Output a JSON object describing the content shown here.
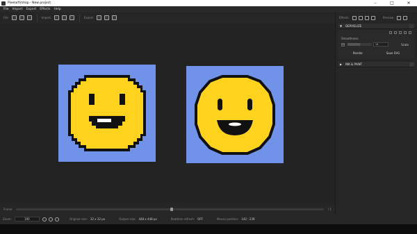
{
  "window": {
    "title": "PixelartVshop - New project",
    "minimize": "–",
    "maximize": "□",
    "close": "✕"
  },
  "menu": [
    "File",
    "Import",
    "Export",
    "Effects",
    "Help"
  ],
  "toolbar": {
    "file_label": "File",
    "import_label": "Import",
    "export_label": "Export"
  },
  "effects_bar": {
    "effects_label": "Effects",
    "preview_label": "Preview"
  },
  "panels": {
    "depixelize": {
      "title": "DEPIXELIZE",
      "collapse_arrow": "▼",
      "smoothness_label": "Smoothness",
      "checkbox_mark": "On",
      "smoothness_value": "14",
      "smoothness_fraction": 0.5,
      "scale_label": "Scale",
      "render_button": "Render",
      "save_svg_button": "Save SVG"
    },
    "ink_paint": {
      "title": "INK & PAINT",
      "expand_arrow": "▶"
    }
  },
  "frame_bar": {
    "label": "Frame",
    "count": "/ 1",
    "position_fraction": 0.5
  },
  "status": {
    "zoom_label": "Zoom:",
    "zoom_value": "100",
    "original_size_label": "Original size:",
    "original_size_value": "32 x 32 px",
    "output_size_label": "Output size:",
    "output_size_value": "448 x 448 px",
    "realtime_label": "Realtime refresh:",
    "realtime_value": "OFF",
    "mouse_label": "Mouse position:",
    "mouse_value": "142 : 239"
  },
  "colors": {
    "canvas_bg": "#7092e8",
    "face_yellow": "#ffd21e",
    "outline": "#111111"
  }
}
